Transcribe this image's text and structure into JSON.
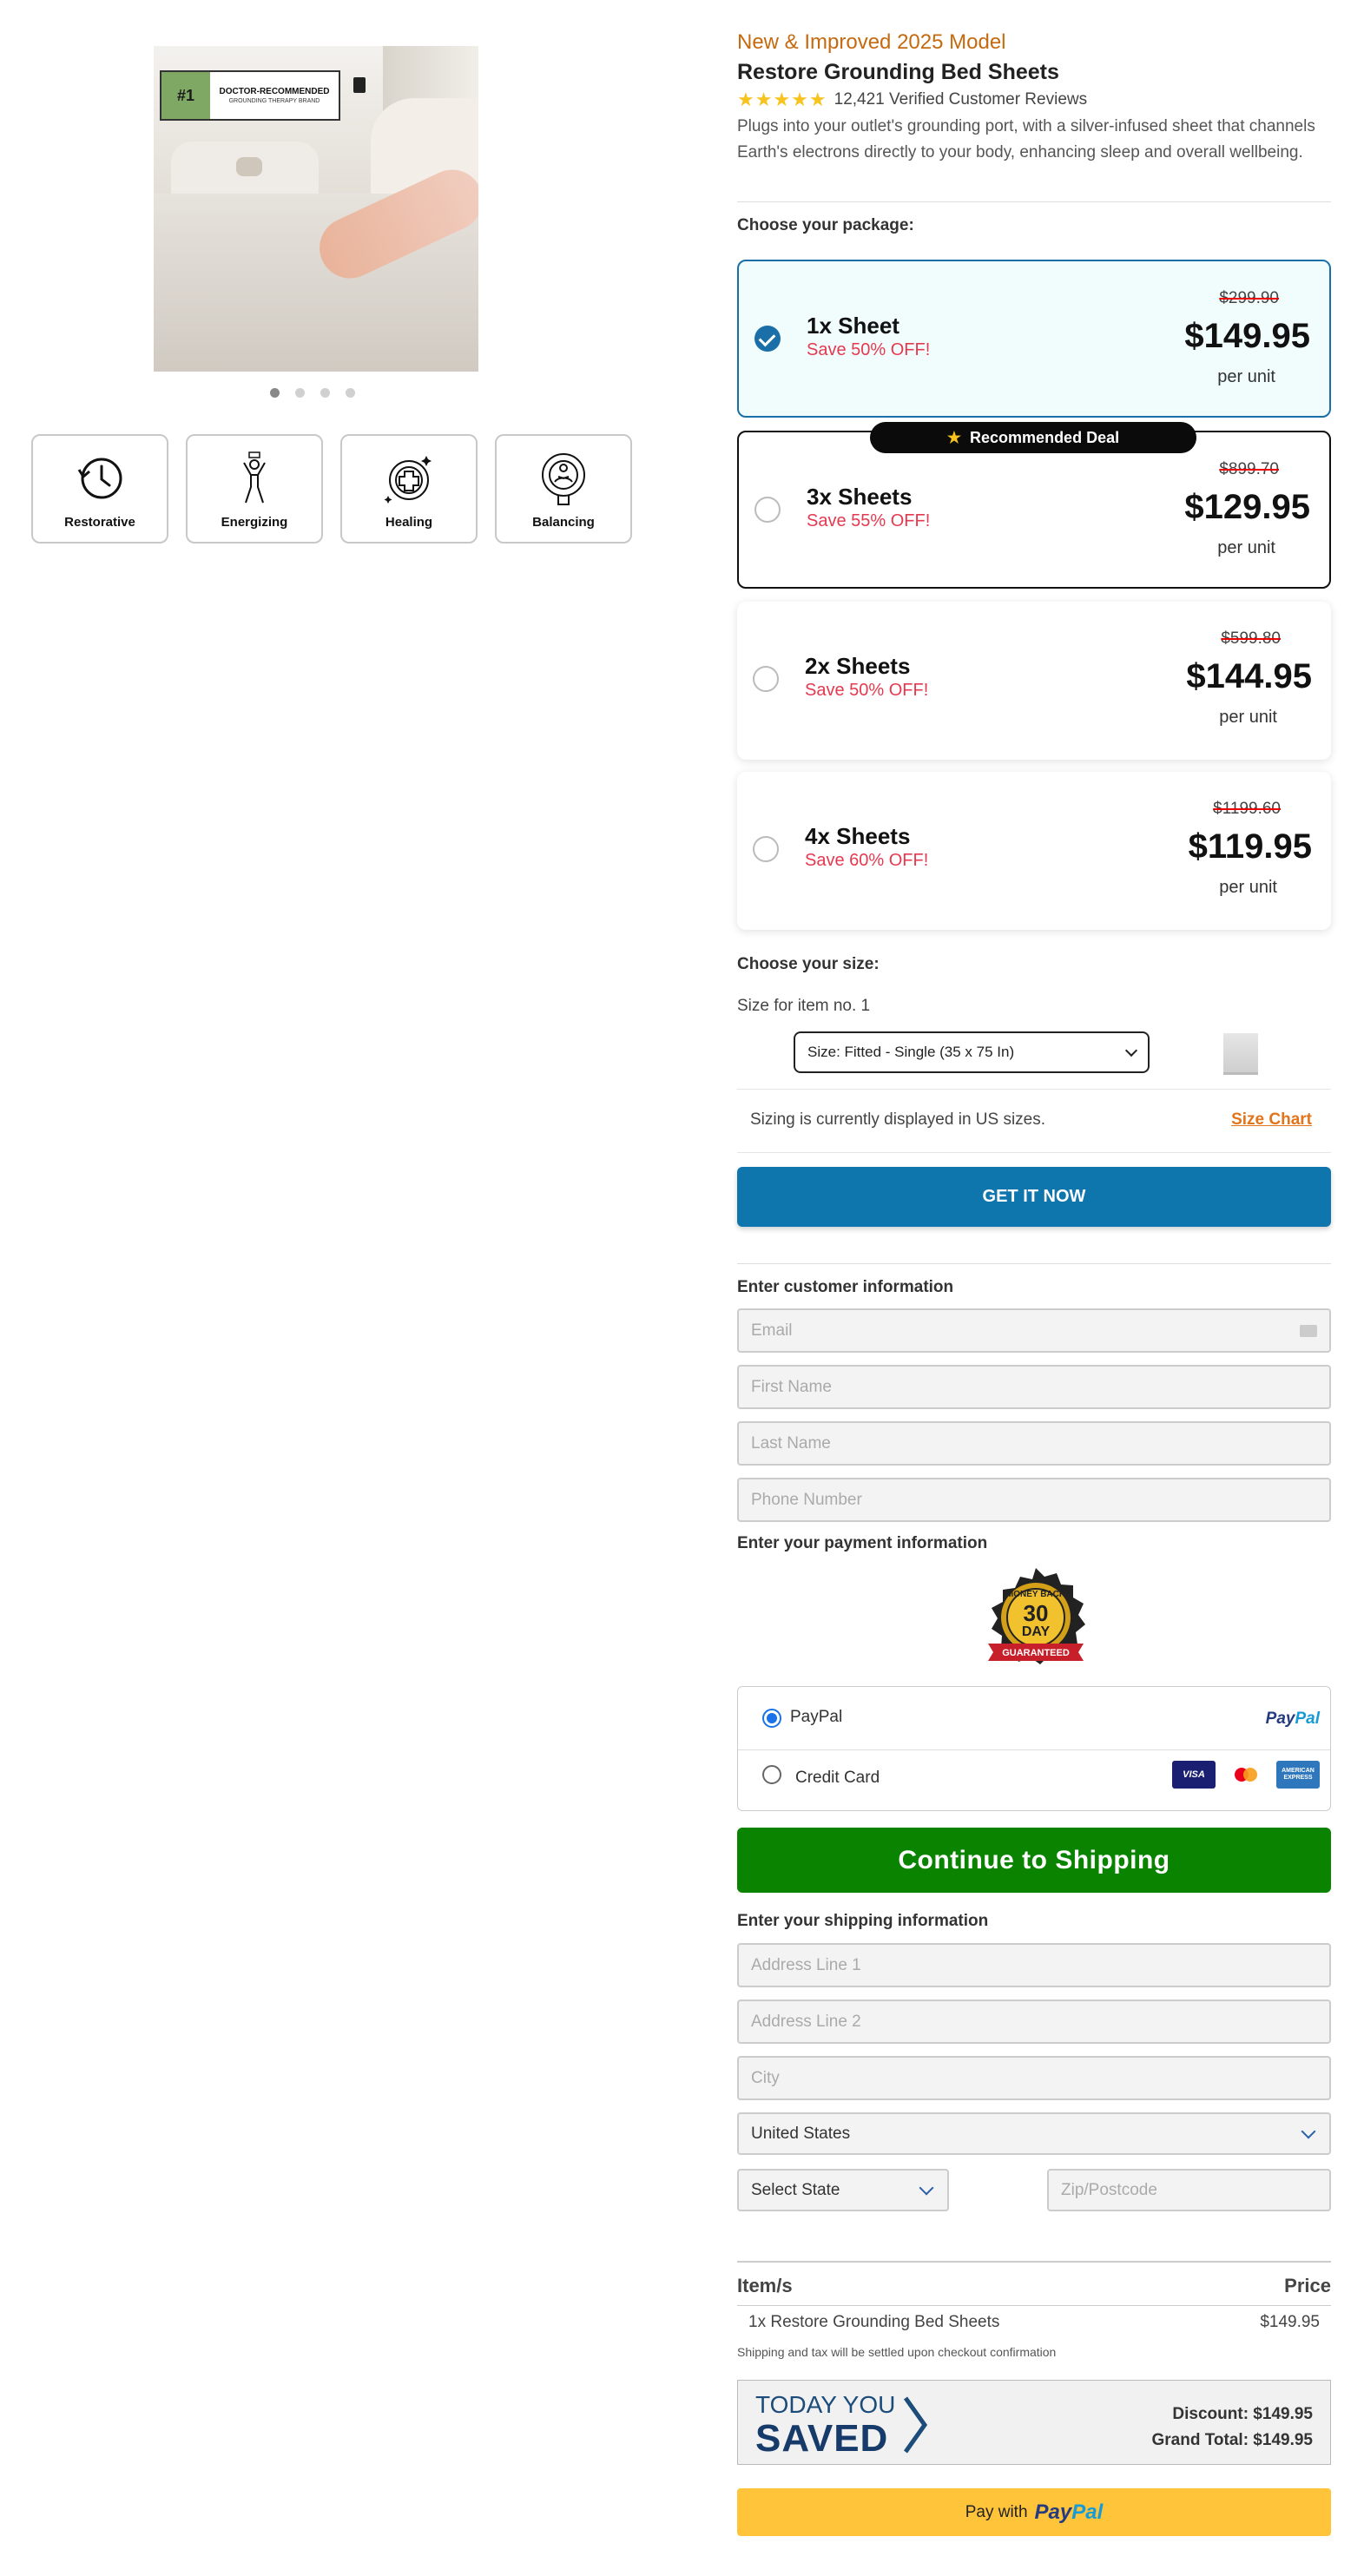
{
  "gallery": {
    "badge_rank": "#1",
    "badge_title": "DOCTOR-RECOMMENDED",
    "badge_sub": "GROUNDING THERAPY BRAND",
    "dots": 4,
    "active_dot": 1
  },
  "benefits": [
    {
      "label": "Restorative",
      "icon": "clock-restore-icon"
    },
    {
      "label": "Energizing",
      "icon": "energy-person-icon"
    },
    {
      "label": "Healing",
      "icon": "medical-cross-icon"
    },
    {
      "label": "Balancing",
      "icon": "meditation-icon"
    }
  ],
  "product": {
    "model_tag": "New & Improved 2025 Model",
    "title": "Restore Grounding Bed Sheets",
    "stars": "★★★★★",
    "rating": 4.5,
    "reviews": "12,421 Verified Customer Reviews",
    "description": "Plugs into your outlet's grounding port, with a silver-infused sheet that channels Earth's electrons directly to your body, enhancing sleep and overall wellbeing."
  },
  "package": {
    "heading": "Choose your package:",
    "recommended_label": "Recommended Deal",
    "options": [
      {
        "name": "1x Sheet",
        "save": "Save 50% OFF!",
        "old_price": "$299.90",
        "price": "$149.95",
        "unit": "per unit",
        "selected": true
      },
      {
        "name": "3x Sheets",
        "save": "Save 55% OFF!",
        "old_price": "$899.70",
        "price": "$129.95",
        "unit": "per unit",
        "selected": false
      },
      {
        "name": "2x Sheets",
        "save": "Save 50% OFF!",
        "old_price": "$599.80",
        "price": "$144.95",
        "unit": "per unit",
        "selected": false
      },
      {
        "name": "4x Sheets",
        "save": "Save 60% OFF!",
        "old_price": "$1199.60",
        "price": "$119.95",
        "unit": "per unit",
        "selected": false
      }
    ]
  },
  "size": {
    "heading": "Choose your size:",
    "item_label": "Size for item no. 1",
    "selected": "Size: Fitted - Single (35 x 75 In)",
    "note": "Sizing is currently displayed in US sizes.",
    "chart_link": "Size Chart"
  },
  "cta": {
    "get_it_now": "GET IT NOW"
  },
  "customer": {
    "heading": "Enter customer information",
    "email_placeholder": "Email",
    "first_name_placeholder": "First Name",
    "last_name_placeholder": "Last Name",
    "phone_placeholder": "Phone Number"
  },
  "payment": {
    "heading": "Enter your payment information",
    "guarantee_top": "MONEY BACK",
    "guarantee_num": "30",
    "guarantee_day": "DAY",
    "guarantee_ribbon": "GUARANTEED",
    "paypal_label": "PayPal",
    "paypal_logo_a": "Pay",
    "paypal_logo_b": "Pal",
    "card_label": "Credit Card",
    "card_visa": "VISA",
    "card_amex": "AMERICAN EXPRESS",
    "selected_method": "PayPal"
  },
  "shipping": {
    "continue": "Continue to Shipping",
    "heading": "Enter your shipping information",
    "address1_placeholder": "Address Line 1",
    "address2_placeholder": "Address Line 2",
    "city_placeholder": "City",
    "country": "United States",
    "state": "Select State",
    "zip_placeholder": "Zip/Postcode"
  },
  "summary": {
    "col_item": "Item/s",
    "col_price": "Price",
    "line_item": "1x Restore Grounding Bed Sheets",
    "line_price": "$149.95",
    "note": "Shipping and tax will be settled upon checkout confirmation",
    "today_you": "TODAY YOU",
    "saved": "SAVED",
    "discount": "Discount: $149.95",
    "grand_total": "Grand Total: $149.95",
    "pay_with": "Pay with",
    "paypal_a": "Pay",
    "paypal_b": "Pal"
  },
  "colors": {
    "accent_blue": "#0e75ad",
    "cta_green": "#0a8400",
    "save_red": "#e53950",
    "model_orange": "#c56a0f",
    "paypal_yellow": "#ffc439"
  }
}
